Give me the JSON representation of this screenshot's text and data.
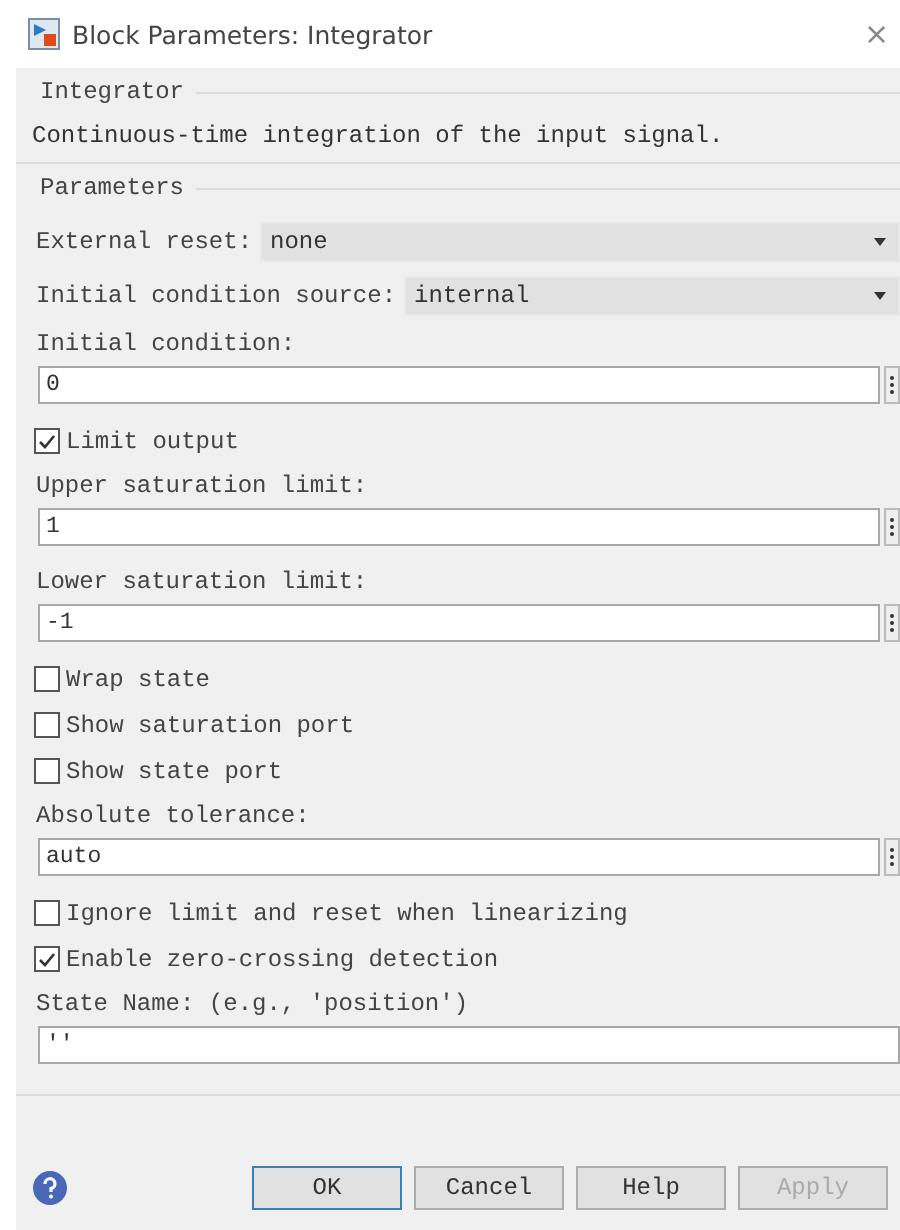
{
  "window": {
    "title": "Block Parameters: Integrator",
    "close": "×"
  },
  "block": {
    "name": "Integrator",
    "description": "Continuous-time integration of the input signal."
  },
  "parameters": {
    "title": "Parameters",
    "items": [
      {
        "kind": "dropdown",
        "label": "External reset:",
        "value": "none"
      },
      {
        "kind": "dropdown",
        "label": "Initial condition source:",
        "value": "internal"
      },
      {
        "kind": "label",
        "label": "Initial condition:"
      },
      {
        "kind": "field",
        "value": "0",
        "more": true
      },
      {
        "kind": "checkbox",
        "label": "Limit output",
        "checked": true
      },
      {
        "kind": "label",
        "label": "Upper saturation limit:"
      },
      {
        "kind": "field",
        "value": "1",
        "more": true
      },
      {
        "kind": "label",
        "label": "Lower saturation limit:"
      },
      {
        "kind": "field",
        "value": "-1",
        "more": true
      },
      {
        "kind": "checkbox",
        "label": "Wrap state",
        "checked": false
      },
      {
        "kind": "checkbox",
        "label": "Show saturation port",
        "checked": false
      },
      {
        "kind": "checkbox",
        "label": "Show state port",
        "checked": false
      },
      {
        "kind": "label",
        "label": "Absolute tolerance:"
      },
      {
        "kind": "field",
        "value": "auto",
        "more": true
      },
      {
        "kind": "checkbox",
        "label": "Ignore limit and reset when linearizing",
        "checked": false
      },
      {
        "kind": "checkbox",
        "label": "Enable zero-crossing detection",
        "checked": true
      },
      {
        "kind": "label",
        "label": "State Name: (e.g., 'position')"
      },
      {
        "kind": "field",
        "value": "''",
        "more": false
      }
    ]
  },
  "buttons": [
    {
      "label": "OK",
      "default": true,
      "disabled": false
    },
    {
      "label": "Cancel",
      "default": false,
      "disabled": false
    },
    {
      "label": "Help",
      "default": false,
      "disabled": false
    },
    {
      "label": "Apply",
      "default": false,
      "disabled": true
    }
  ]
}
